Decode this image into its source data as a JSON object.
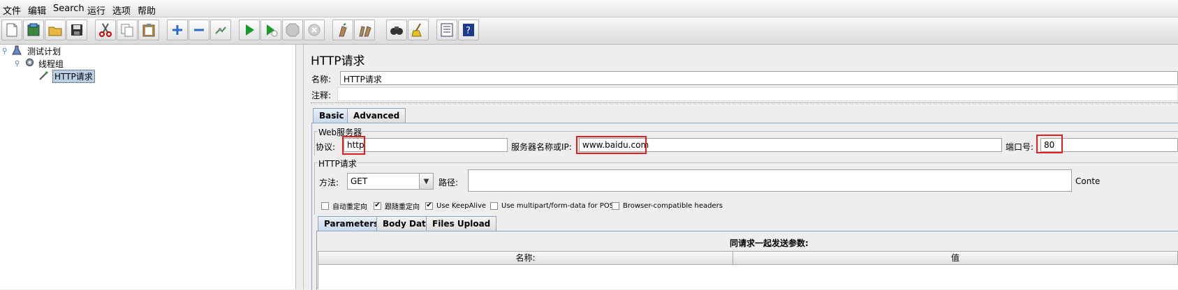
{
  "menu": [
    "文件",
    "编辑",
    "Search",
    "运行",
    "选项",
    "帮助"
  ],
  "toolbar_icons": [
    "new-icon",
    "templates-icon",
    "open-icon",
    "save-icon",
    "cut-icon",
    "copy-icon",
    "paste-icon",
    "expand-icon",
    "collapse-icon",
    "toggle-icon",
    "start-icon",
    "start-no-pause-icon",
    "stop-icon",
    "shutdown-icon",
    "clear-icon",
    "clear-all-icon",
    "search-icon",
    "reset-search-icon",
    "function-helper-icon",
    "help-icon"
  ],
  "tree": {
    "plan": "测试计划",
    "thread_group": "线程组",
    "sampler": "HTTP请求"
  },
  "panel": {
    "title": "HTTP请求",
    "name_label": "名称:",
    "name_value": "HTTP请求",
    "comment_label": "注释:",
    "comment_value": ""
  },
  "tabs": [
    "Basic",
    "Advanced"
  ],
  "web_server": {
    "legend": "Web服务器",
    "protocol_label": "协议:",
    "protocol_value": "http",
    "server_label": "服务器名称或IP:",
    "server_value": "www.baidu.com",
    "port_label": "端口号:",
    "port_value": "80"
  },
  "http_request": {
    "legend": "HTTP请求",
    "method_label": "方法:",
    "method_value": "GET",
    "path_label": "路径:",
    "path_value": "",
    "content_label": "Conte"
  },
  "options": [
    {
      "label": "自动重定向",
      "checked": false
    },
    {
      "label": "跟随重定向",
      "checked": true
    },
    {
      "label": "Use KeepAlive",
      "checked": true
    },
    {
      "label": "Use multipart/form-data for POST",
      "checked": false
    },
    {
      "label": "Browser-compatible headers",
      "checked": false
    }
  ],
  "param_tabs": [
    "Parameters",
    "Body Data",
    "Files Upload"
  ],
  "params_table": {
    "caption": "同请求一起发送参数:",
    "columns": [
      "名称:",
      "值"
    ]
  },
  "colors": {
    "highlight": "#e02020",
    "selection": "#b8cfe5"
  }
}
